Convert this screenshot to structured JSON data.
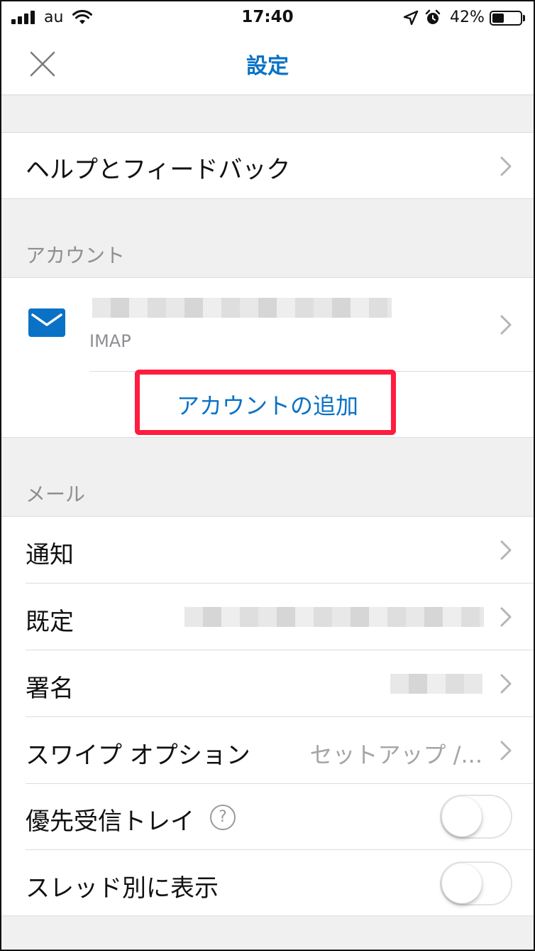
{
  "status_bar": {
    "carrier": "au",
    "time": "17:40",
    "battery_percent": "42%",
    "battery_level": 0.42,
    "icons": [
      "signal-icon",
      "wifi-icon",
      "location-icon",
      "alarm-icon",
      "battery-icon"
    ]
  },
  "nav": {
    "title": "設定",
    "close_icon": "close-icon"
  },
  "help": {
    "label": "ヘルプとフィードバック"
  },
  "accounts": {
    "header": "アカウント",
    "account_type": "IMAP",
    "account_icon": "mail-icon",
    "add_account": "アカウントの追加"
  },
  "mail": {
    "header": "メール",
    "rows": {
      "notifications": "通知",
      "default": "既定",
      "signature": "署名",
      "swipe_options": "スワイプ オプション",
      "swipe_value": "セットアップ /...",
      "focused_inbox": "優先受信トレイ",
      "focused_help": "?",
      "threading": "スレッド別に表示"
    },
    "toggles": {
      "focused_inbox_on": false,
      "threading_on": false
    }
  },
  "colors": {
    "accent": "#0a72c6",
    "highlight_box": "#ff1c3f",
    "secondary_text": "#8e8e93"
  }
}
